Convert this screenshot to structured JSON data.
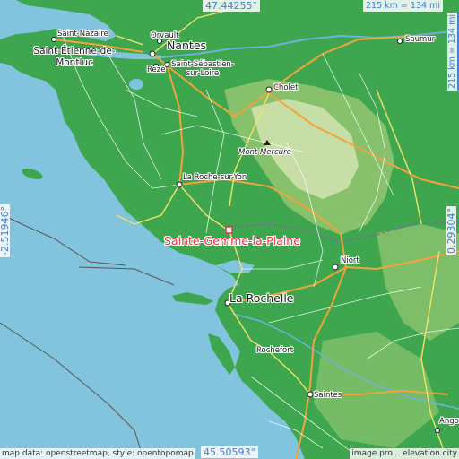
{
  "coordinates": {
    "top": "47.44255°",
    "bottom": "45.50593°",
    "left": "-2.51946°",
    "right": "0.29304°"
  },
  "scale": {
    "horizontal": "215 km = 134 mi",
    "vertical": "215 km = 134 mi"
  },
  "target": {
    "name": "Sainte-Gemme-la-Plaine"
  },
  "places": {
    "saint_nazaire": "Saint-Nazaire",
    "orvault": "Orvault",
    "nantes": "Nantes",
    "saint_etienne_line1": "Saint-Étienne-de-",
    "saint_etienne_line2": "Montluc",
    "reze": "Rezé",
    "saint_sebastien_line1": "Saint-Sébastien-",
    "saint_sebastien_line2": "sur-Loire",
    "saumur": "Saumur",
    "cholet": "Cholet",
    "mont_mercure": "Mont Mercure",
    "la_roche": "La Roche-sur-Yon",
    "niort": "Niort",
    "la_rochelle": "La Rochelle",
    "rochefort": "Rochefort",
    "saintes": "Saintes",
    "angouleme": "Angou"
  },
  "attribution": {
    "left": "map data: openstreetmap, style: opentopomap",
    "right": "image pro... elevation.city"
  },
  "colors": {
    "sea": "#82c4de",
    "lowland": "#3ea64e",
    "upland": "#8fc46f",
    "highland": "#d2e3b0",
    "target": "#e8344a",
    "coordinate_text": "#3e7ed3"
  }
}
